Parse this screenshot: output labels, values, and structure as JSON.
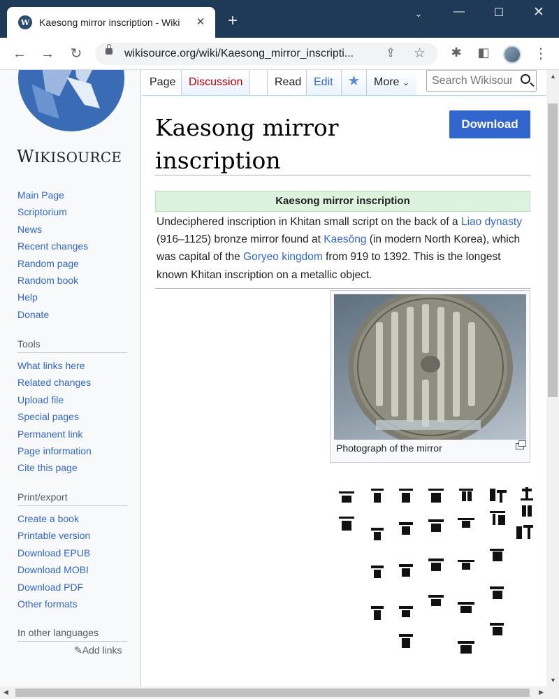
{
  "browser": {
    "tab_title": "Kaesong mirror inscription - Wiki",
    "url": "wikisource.org/wiki/Kaesong_mirror_inscripti...",
    "icons": [
      "back-icon",
      "forward-icon",
      "reload-icon",
      "lock-icon",
      "share-icon",
      "star-icon",
      "extensions-icon",
      "side-panel-icon",
      "profile-avatar",
      "menu-icon",
      "close-icon",
      "new-tab-icon",
      "minimize-icon",
      "maximize-icon",
      "window-close-icon"
    ]
  },
  "site": {
    "logo_text": "Wikisource",
    "sidebar": {
      "nav": [
        "Main Page",
        "Scriptorium",
        "News",
        "Recent changes",
        "Random page",
        "Random book",
        "Help",
        "Donate"
      ],
      "tools_heading": "Tools",
      "tools": [
        "What links here",
        "Related changes",
        "Upload file",
        "Special pages",
        "Permanent link",
        "Page information",
        "Cite this page"
      ],
      "print_heading": "Print/export",
      "print": [
        "Create a book",
        "Printable version",
        "Download EPUB",
        "Download MOBI",
        "Download PDF",
        "Other formats"
      ],
      "languages_heading": "In other languages",
      "add_links": "Add links"
    },
    "tabs": {
      "page": "Page",
      "discussion": "Discussion",
      "read": "Read",
      "edit": "Edit",
      "more": "More",
      "search_placeholder": "Search Wikisour"
    }
  },
  "article": {
    "title": "Kaesong mirror inscription",
    "download_label": "Download",
    "infobox_heading": "Kaesong mirror inscription",
    "intro": {
      "t1": "Undeciphered inscription in Khitan small script on the back of a ",
      "link1": "Liao dynasty",
      "t2": " (916–1125) bronze mirror found at ",
      "link2": "Kaesŏng",
      "t3": " (in modern North Korea), which was capital of the ",
      "link3": "Goryeo kingdom",
      "t4": " from 919 to 1392. This is the longest known Khitan inscription on a metallic object."
    },
    "figure_caption": "Photograph of the mirror",
    "colors": {
      "link": "#3366cc",
      "button": "#3366cc",
      "infobox_header": "#ddf3dd",
      "red_link": "#ba0000"
    }
  }
}
